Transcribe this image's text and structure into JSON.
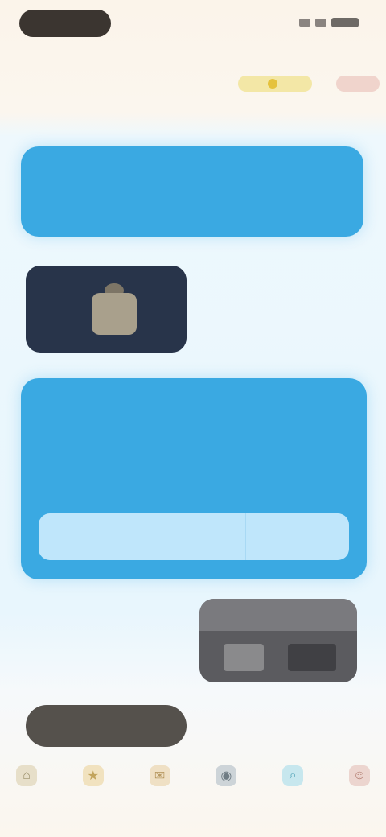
{
  "status_bar": {
    "time": ""
  },
  "header": {
    "title": "",
    "subtitle": "",
    "coin_label": "",
    "gift_label": ""
  },
  "chat": {
    "message1": {
      "line1": "",
      "line2": ""
    },
    "media_card": {
      "caption": ""
    },
    "message2": {
      "label": "",
      "title": "",
      "note": "",
      "options": [
        "",
        "",
        ""
      ]
    },
    "reply_card": {
      "caption": ""
    }
  },
  "composer": {
    "placeholder": ""
  },
  "tabbar": {
    "icons": [
      "home-icon",
      "star-icon",
      "chat-icon",
      "camera-icon",
      "search-icon",
      "profile-icon"
    ]
  },
  "colors": {
    "accent_blue": "#3aa9e2",
    "background": "#fbf6ee",
    "option_bar": "#bfe6fb",
    "dark_card": "#28344a"
  }
}
